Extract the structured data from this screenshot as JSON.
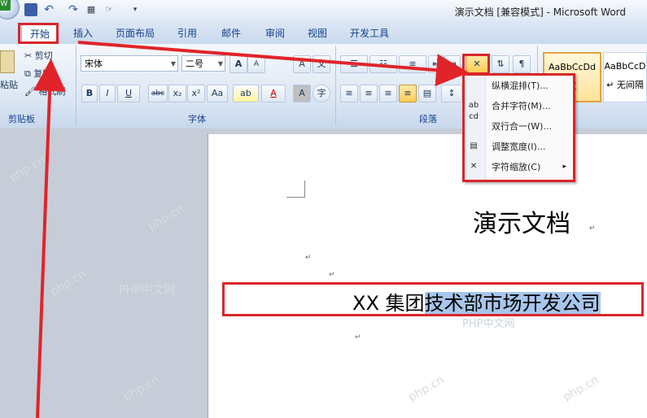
{
  "titlebar": {
    "title": "演示文档 [兼容模式] - Microsoft Word"
  },
  "tabs": [
    "开始",
    "插入",
    "页面布局",
    "引用",
    "邮件",
    "审阅",
    "视图",
    "开发工具"
  ],
  "clipboard": {
    "paste": "粘贴",
    "cut": "剪切",
    "copy": "复制",
    "format_painter": "格式刷",
    "group": "剪贴板"
  },
  "font": {
    "name": "宋体",
    "size": "二号",
    "group": "字体",
    "bold": "B",
    "italic": "I",
    "underline": "U",
    "strike": "abc",
    "sub": "x₂",
    "sup": "x²",
    "case": "Aa",
    "grow": "A",
    "shrink": "A",
    "clear": "A",
    "highlight": "ab",
    "color": "A",
    "charshade": "A",
    "enclose": "字"
  },
  "paragraph": {
    "group": "段落"
  },
  "styles": {
    "s1": "AaBbCcDd",
    "s1_name": "文",
    "s2": "AaBbCcD",
    "s2_name": "↵ 无间隔"
  },
  "menu": {
    "items": [
      {
        "icon": "",
        "label": "纵横混排(T)..."
      },
      {
        "icon": "ab cd",
        "label": "合并字符(M)..."
      },
      {
        "icon": "",
        "label": "双行合一(W)..."
      },
      {
        "icon": "▤",
        "label": "调整宽度(I)..."
      },
      {
        "icon": "✕",
        "label": "字符缩放(C)",
        "arrow": "▸"
      }
    ]
  },
  "document": {
    "title": "演示文档",
    "line_prefix": "XX 集团",
    "line_selected": "技术部市场开发公司",
    "pilcrow": "↵"
  },
  "watermarks": [
    "php.cn",
    "php.cn",
    "php.cn",
    "php.cn",
    "PHP中文网",
    "PHP中文网",
    "php.cn",
    "php.cn"
  ]
}
